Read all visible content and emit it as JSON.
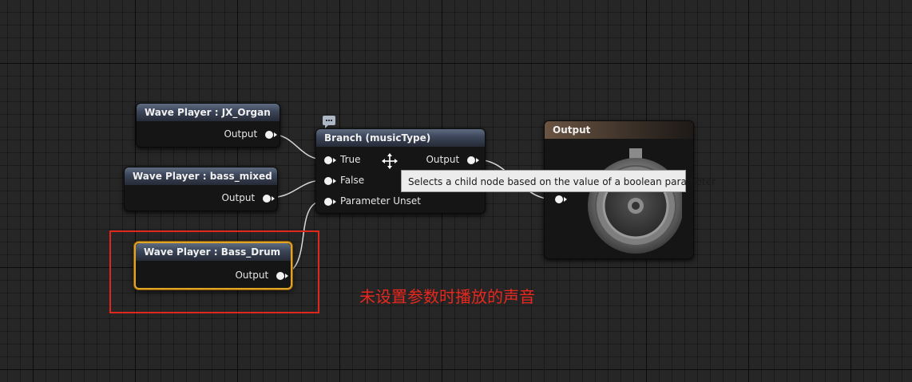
{
  "nodes": {
    "jx_organ": {
      "title": "Wave Player : JX_Organ",
      "output_label": "Output"
    },
    "bass_mixed": {
      "title": "Wave Player : bass_mixed",
      "output_label": "Output"
    },
    "bass_drum": {
      "title": "Wave Player : Bass_Drum",
      "output_label": "Output"
    },
    "branch": {
      "title": "Branch (musicType)",
      "inputs": [
        "True",
        "False",
        "Parameter Unset"
      ],
      "output_label": "Output"
    },
    "output": {
      "title": "Output"
    }
  },
  "tooltip": {
    "text": "Selects a child node based on the value of a boolean parameter"
  },
  "annotation": {
    "text": "未设置参数时播放的声音",
    "color": "#e8281e"
  },
  "colors": {
    "selection": "#e0a526",
    "pin": "#f2f2f2",
    "wire": "#d8d8d8"
  },
  "icons": [
    "comment-bubble-icon",
    "move-cursor-icon",
    "speaker-icon"
  ]
}
